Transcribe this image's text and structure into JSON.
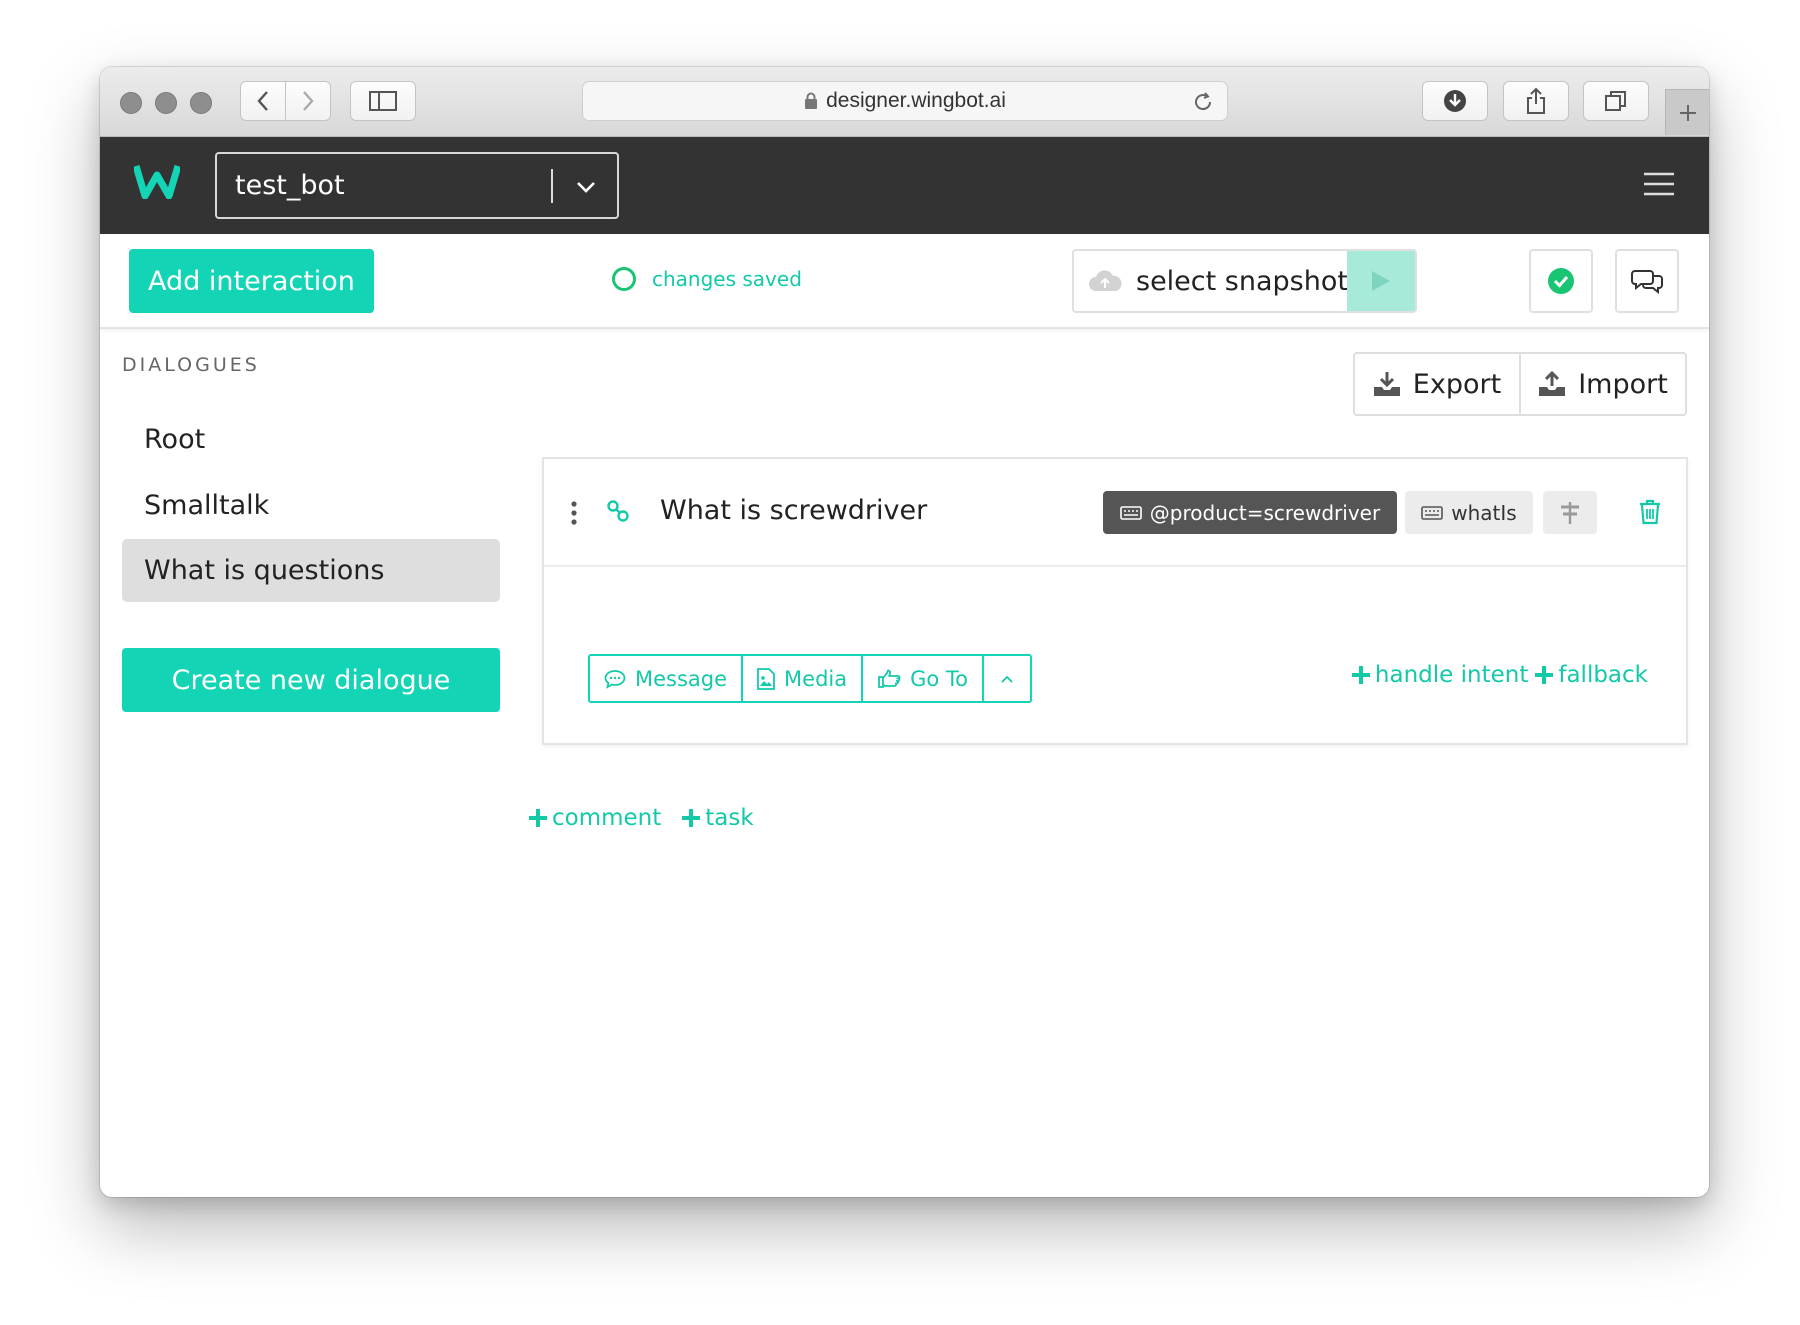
{
  "browser": {
    "url": "designer.wingbot.ai"
  },
  "header": {
    "bot_name": "test_bot"
  },
  "toolbar": {
    "add_interaction": "Add interaction",
    "status": "changes saved",
    "snapshot_label": "select snapshot"
  },
  "sidebar": {
    "title": "DIALOGUES",
    "items": [
      {
        "label": "Root"
      },
      {
        "label": "Smalltalk"
      },
      {
        "label": "What is questions"
      }
    ],
    "create_button": "Create new dialogue"
  },
  "main": {
    "export_label": "Export",
    "import_label": "Import",
    "interaction": {
      "title": "What is screwdriver",
      "entity_tag": "@product=screwdriver",
      "intent_tag": "whatIs",
      "actions": [
        {
          "label": "Message",
          "icon": "speech-bubble-icon"
        },
        {
          "label": "Media",
          "icon": "image-icon"
        },
        {
          "label": "Go To",
          "icon": "pointing-hand-icon"
        }
      ],
      "handle_intent": "handle intent",
      "fallback": "fallback"
    },
    "comment_link": "comment",
    "task_link": "task"
  },
  "colors": {
    "accent": "#13d4b4",
    "header_bg": "#333333",
    "saved_ring": "#19c472"
  }
}
